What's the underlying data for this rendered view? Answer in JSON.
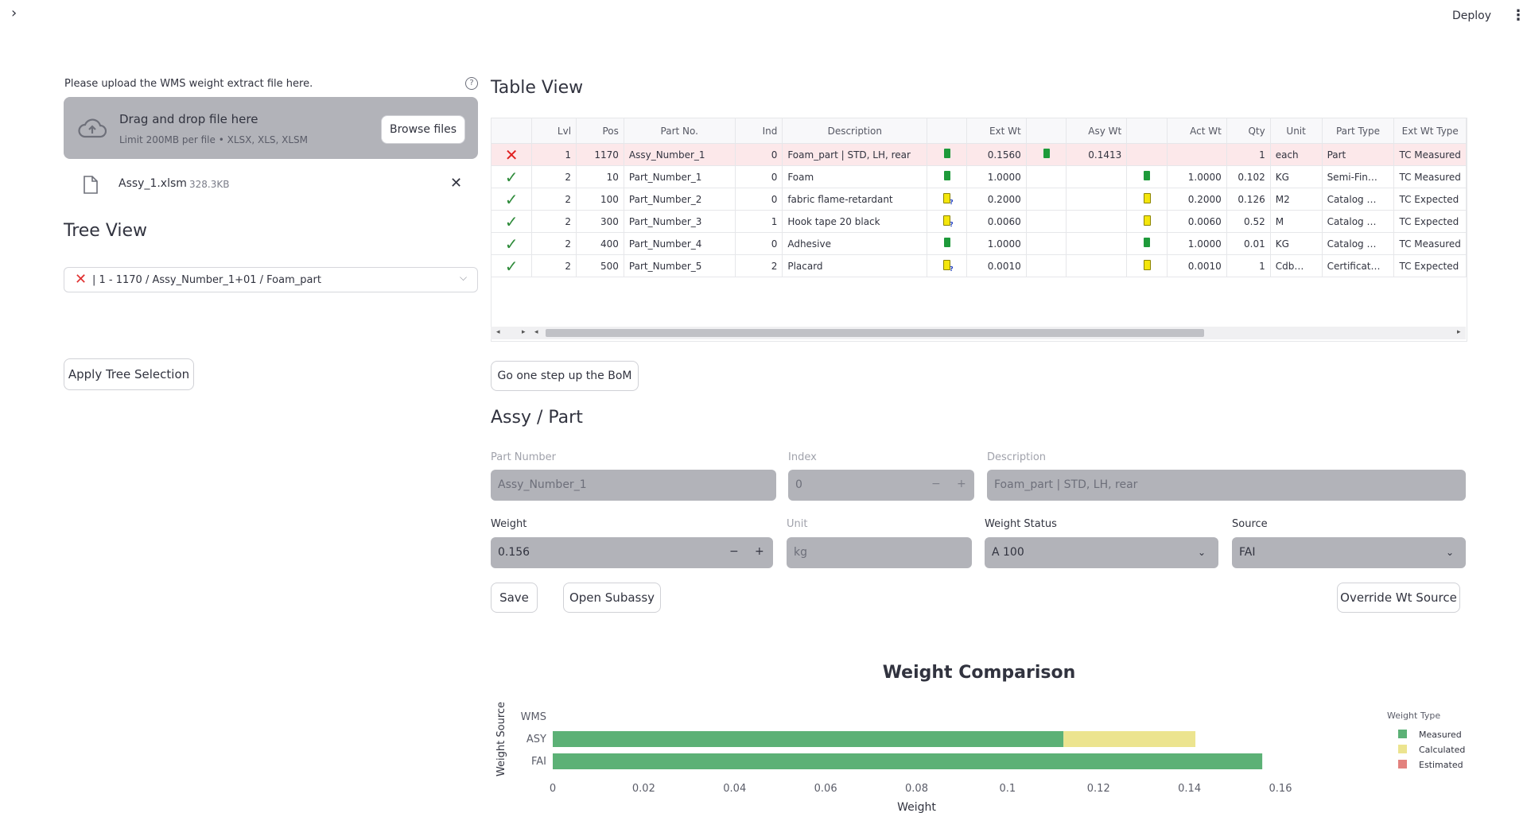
{
  "header": {
    "deploy_label": "Deploy"
  },
  "upload": {
    "label": "Please upload the WMS weight extract file here.",
    "help": "?",
    "drop_title": "Drag and drop file here",
    "drop_limit": "Limit 200MB per file • XLSX, XLS, XLSM",
    "browse_label": "Browse files",
    "file_name": "Assy_1.xlsm",
    "file_size": "328.3KB"
  },
  "tree": {
    "title": "Tree View",
    "selected": "| 1 - 1170 / Assy_Number_1+01 / Foam_part",
    "apply_label": "Apply Tree Selection"
  },
  "table_view": {
    "title": "Table View",
    "columns": [
      "Lvl",
      "Pos",
      "Part No.",
      "Ind",
      "Description",
      "",
      "Ext Wt",
      "",
      "Asy Wt",
      "",
      "Act Wt",
      "Qty",
      "Unit",
      "Part Type",
      "Ext Wt Type"
    ],
    "rows": [
      {
        "status": "cross",
        "lvl": "1",
        "pos": "1170",
        "part": "Assy_Number_1",
        "ind": "0",
        "desc": "Foam_part | STD, LH, rear",
        "b1": "g",
        "ext": "0.1560",
        "b2": "gc",
        "asy": "0.1413",
        "b3": "",
        "act": "",
        "qty": "1",
        "unit": "each",
        "type": "Part",
        "exttype": "TC Measured"
      },
      {
        "status": "tick",
        "lvl": "2",
        "pos": "10",
        "part": "Part_Number_1",
        "ind": "0",
        "desc": "Foam",
        "b1": "g",
        "ext": "1.0000",
        "b2": "",
        "asy": "",
        "b3": "g",
        "act": "1.0000",
        "qty": "0.102",
        "unit": "KG",
        "type": "Semi-Fin…",
        "exttype": "TC Measured"
      },
      {
        "status": "tick",
        "lvl": "2",
        "pos": "100",
        "part": "Part_Number_2",
        "ind": "0",
        "desc": "fabric flame-retardant",
        "b1": "yq",
        "ext": "0.2000",
        "b2": "",
        "asy": "",
        "b3": "y",
        "act": "0.2000",
        "qty": "0.126",
        "unit": "M2",
        "type": "Catalog …",
        "exttype": "TC Expected"
      },
      {
        "status": "tick",
        "lvl": "2",
        "pos": "300",
        "part": "Part_Number_3",
        "ind": "1",
        "desc": "Hook tape 20 black",
        "b1": "yq",
        "ext": "0.0060",
        "b2": "",
        "asy": "",
        "b3": "y",
        "act": "0.0060",
        "qty": "0.52",
        "unit": "M",
        "type": "Catalog …",
        "exttype": "TC Expected"
      },
      {
        "status": "tick",
        "lvl": "2",
        "pos": "400",
        "part": "Part_Number_4",
        "ind": "0",
        "desc": "Adhesive",
        "b1": "g",
        "ext": "1.0000",
        "b2": "",
        "asy": "",
        "b3": "g",
        "act": "1.0000",
        "qty": "0.01",
        "unit": "KG",
        "type": "Catalog …",
        "exttype": "TC Measured"
      },
      {
        "status": "tick",
        "lvl": "2",
        "pos": "500",
        "part": "Part_Number_5",
        "ind": "2",
        "desc": "Placard",
        "b1": "yq",
        "ext": "0.0010",
        "b2": "",
        "asy": "",
        "b3": "y",
        "act": "0.0010",
        "qty": "1",
        "unit": "Cdb…",
        "type": "Certificat…",
        "exttype": "TC Expected"
      }
    ],
    "up_label": "Go one step up the BoM"
  },
  "assy_part": {
    "title": "Assy / Part",
    "part_number_label": "Part Number",
    "part_number_value": "Assy_Number_1",
    "index_label": "Index",
    "index_value": "0",
    "description_label": "Description",
    "description_value": "Foam_part | STD, LH, rear",
    "weight_label": "Weight",
    "weight_value": "0.156",
    "unit_label": "Unit",
    "unit_value": "kg",
    "status_label": "Weight Status",
    "status_value": "A 100",
    "source_label": "Source",
    "source_value": "FAI",
    "save_label": "Save",
    "open_subassy_label": "Open Subassy",
    "override_label": "Override Wt Source"
  },
  "chart_data": {
    "type": "bar",
    "orientation": "horizontal",
    "stacked": true,
    "title": "Weight Comparison",
    "xlabel": "Weight",
    "ylabel": "Weight Source",
    "categories": [
      "WMS",
      "ASY",
      "FAI"
    ],
    "series": [
      {
        "name": "Measured",
        "color": "#5cb176",
        "values": [
          0,
          0.1123,
          0.156
        ]
      },
      {
        "name": "Calculated",
        "color": "#ece48f",
        "values": [
          0,
          0.029,
          0
        ]
      },
      {
        "name": "Estimated",
        "color": "#e3827e",
        "values": [
          0,
          0,
          0
        ]
      }
    ],
    "xlim": [
      0,
      0.16
    ],
    "xticks": [
      "0",
      "0.02",
      "0.04",
      "0.06",
      "0.08",
      "0.1",
      "0.12",
      "0.14",
      "0.16"
    ],
    "legend_title": "Weight Type",
    "legend_position": "right"
  }
}
